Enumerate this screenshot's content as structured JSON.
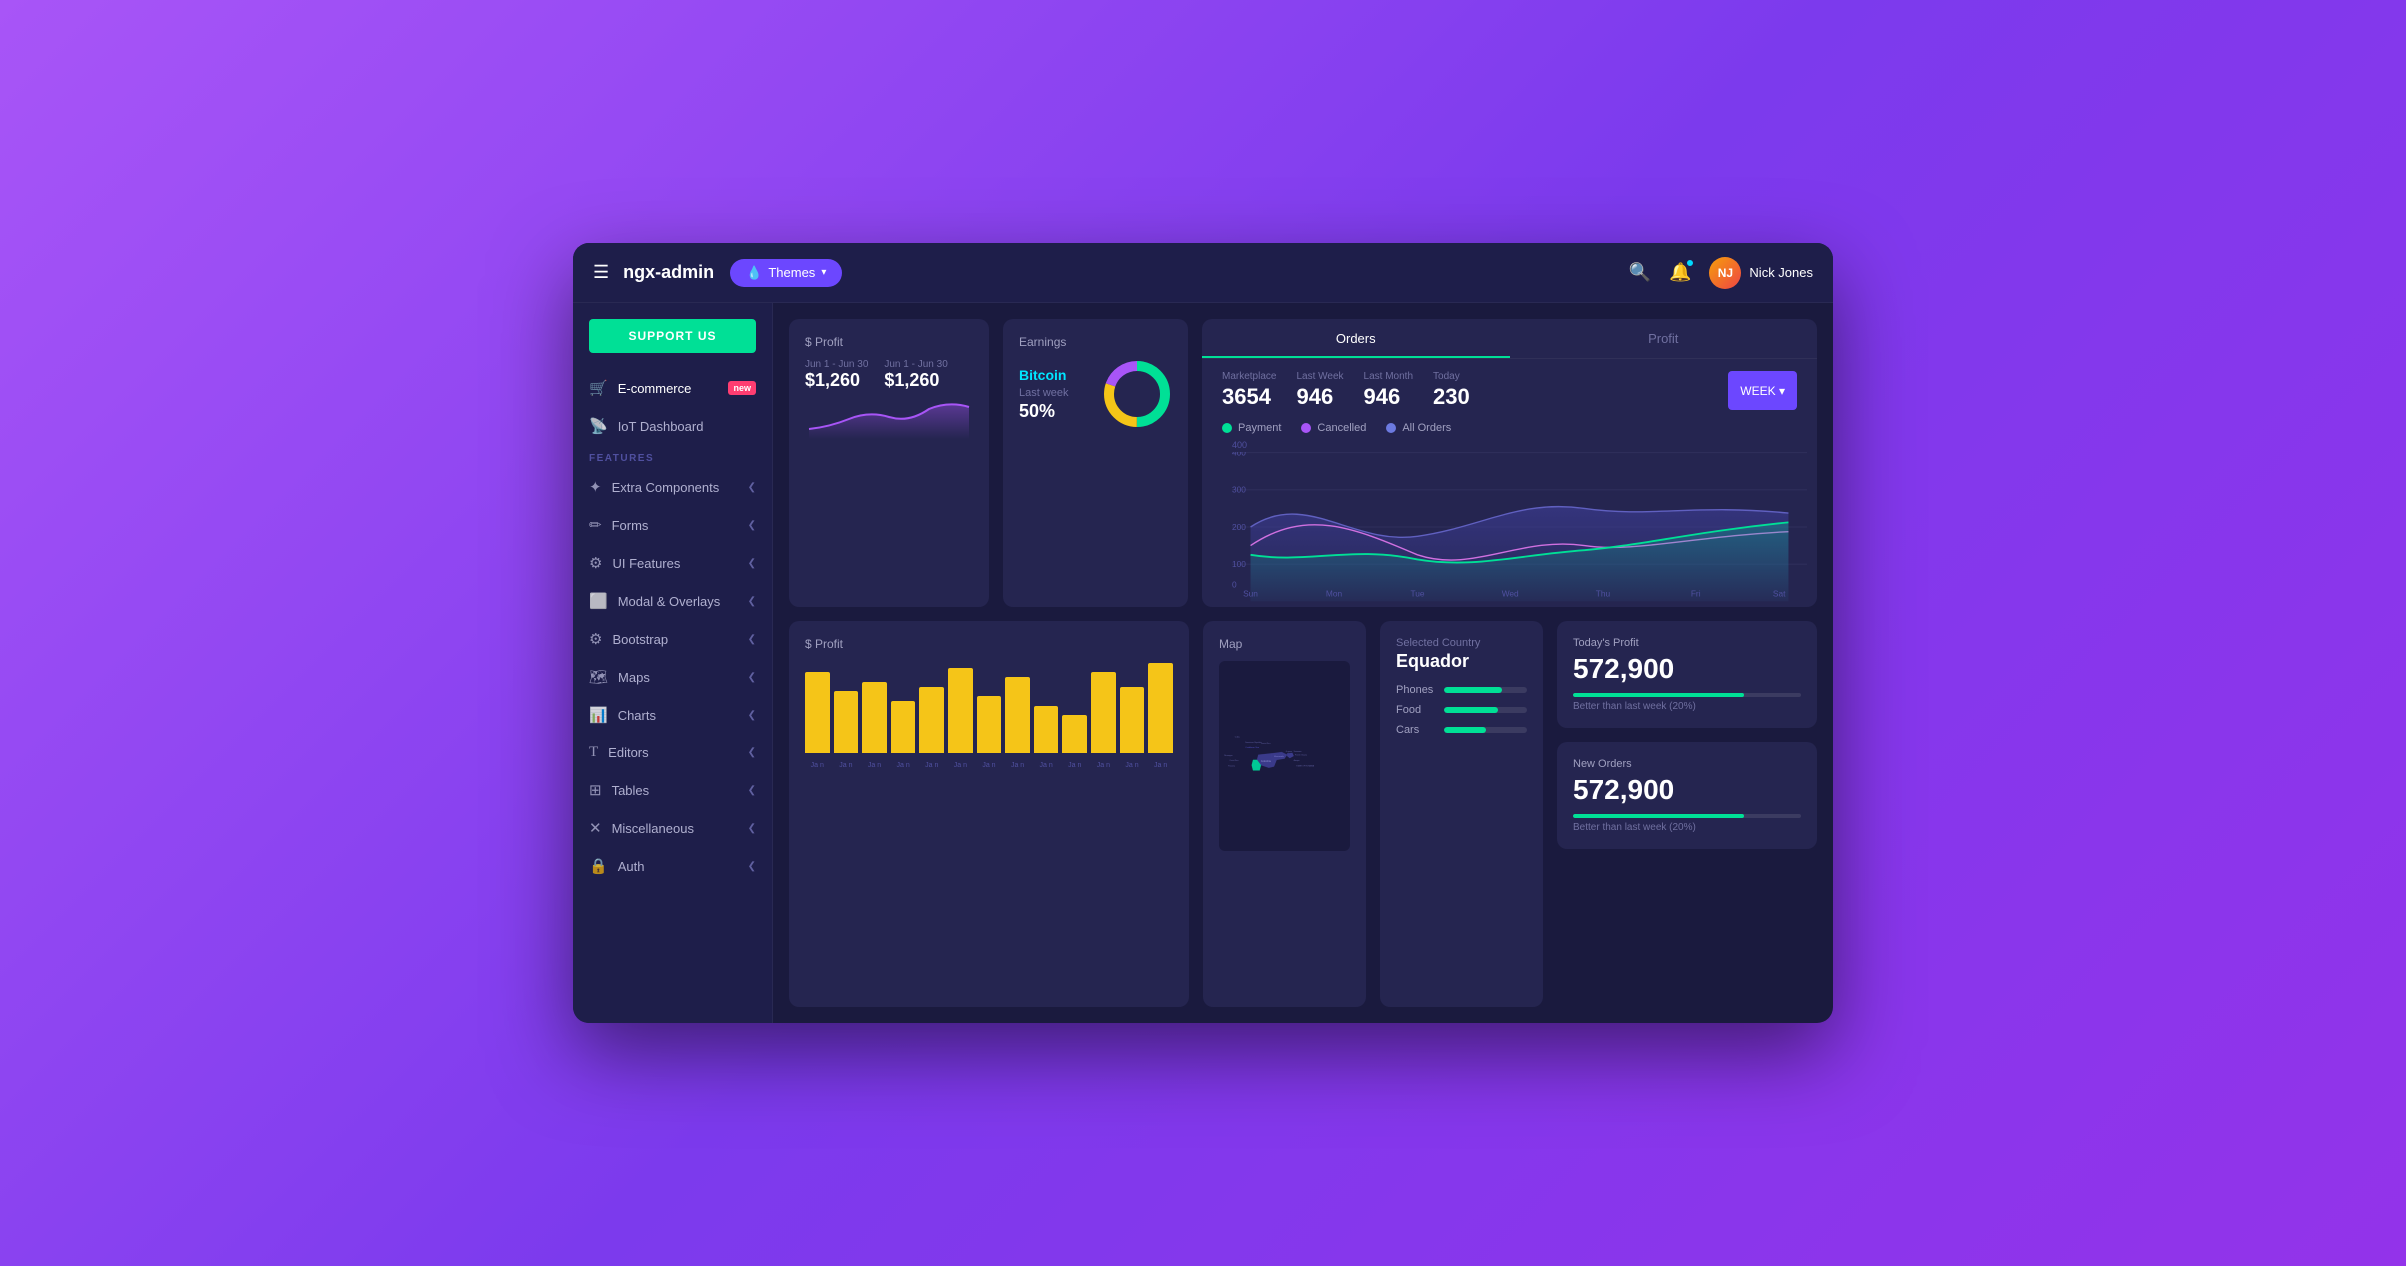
{
  "header": {
    "hamburger": "☰",
    "logo": "ngx-admin",
    "themes_label": "Themes",
    "themes_icon": "💧",
    "search_icon": "🔍",
    "notif_icon": "🔔",
    "user_name": "Nick Jones",
    "user_initials": "NJ"
  },
  "sidebar": {
    "support_label": "SUPPORT US",
    "nav_main": [
      {
        "id": "ecommerce",
        "label": "E-commerce",
        "icon": "🛒",
        "badge": "new"
      },
      {
        "id": "iot",
        "label": "IoT Dashboard",
        "icon": "📡"
      }
    ],
    "features_label": "FEATURES",
    "nav_features": [
      {
        "id": "extra",
        "label": "Extra Components",
        "icon": "✦",
        "chevron": "❮"
      },
      {
        "id": "forms",
        "label": "Forms",
        "icon": "✏",
        "chevron": "❮"
      },
      {
        "id": "ui",
        "label": "UI Features",
        "icon": "⚙",
        "chevron": "❮"
      },
      {
        "id": "modal",
        "label": "Modal & Overlays",
        "icon": "⬜",
        "chevron": "❮"
      },
      {
        "id": "bootstrap",
        "label": "Bootstrap",
        "icon": "⚙",
        "chevron": "❮"
      },
      {
        "id": "maps",
        "label": "Maps",
        "icon": "🗺",
        "chevron": "❮"
      },
      {
        "id": "charts",
        "label": "Charts",
        "icon": "📊",
        "chevron": "❮"
      },
      {
        "id": "editors",
        "label": "Editors",
        "icon": "T",
        "chevron": "❮"
      },
      {
        "id": "tables",
        "label": "Tables",
        "icon": "⊞",
        "chevron": "❮"
      },
      {
        "id": "misc",
        "label": "Miscellaneous",
        "icon": "✕",
        "chevron": "❮"
      },
      {
        "id": "auth",
        "label": "Auth",
        "icon": "🔒",
        "chevron": "❮"
      }
    ]
  },
  "profit_card": {
    "title": "$ Profit",
    "date1": "Jun 1 - Jun 30",
    "date2": "Jun 1 - Jun 30",
    "value1": "$1,260",
    "value2": "$1,260"
  },
  "earnings_card": {
    "title": "Earnings",
    "crypto": "Bitcoin",
    "last_week_label": "Last week",
    "percent": "50%",
    "donut_green": 50,
    "donut_yellow": 30,
    "donut_purple": 20
  },
  "orders": {
    "tab_orders": "Orders",
    "tab_profit": "Profit",
    "stats": [
      {
        "label": "Marketplace",
        "value": "3654"
      },
      {
        "label": "Last Week",
        "value": "946"
      },
      {
        "label": "Last Month",
        "value": "946"
      },
      {
        "label": "Today",
        "value": "230"
      }
    ],
    "legend": [
      {
        "label": "Payment",
        "color": "#00e096"
      },
      {
        "label": "Cancelled",
        "color": "#a855f7"
      },
      {
        "label": "All Orders",
        "color": "#6c7ae0"
      }
    ],
    "week_btn": "WEEK",
    "y_axis": [
      "0",
      "100",
      "200",
      "300",
      "400"
    ],
    "x_axis": [
      "Sun",
      "Mon",
      "Tue",
      "Wed",
      "Thu",
      "Fri",
      "Sat"
    ]
  },
  "bar_chart": {
    "title": "$ Profit",
    "bars": [
      85,
      65,
      75,
      55,
      70,
      90,
      60,
      80,
      50,
      40,
      85,
      70,
      95
    ],
    "labels": [
      "Ja n",
      "Ja n",
      "Ja n",
      "Ja n",
      "Ja n",
      "Ja n",
      "Ja n",
      "Ja n",
      "Ja n",
      "Ja n",
      "Ja n",
      "Ja n",
      "Ja n"
    ]
  },
  "map": {
    "title": "Map",
    "selected_country_label": "Selected Country",
    "country": "Equador",
    "stats": [
      {
        "label": "Phones",
        "pct": 70
      },
      {
        "label": "Food",
        "pct": 65
      },
      {
        "label": "Cars",
        "pct": 50
      }
    ]
  },
  "todays_profit": {
    "title": "Today's Profit",
    "value": "572,900",
    "progress": 75,
    "progress_label": "Better than last week (20%)"
  },
  "new_orders": {
    "title": "New Orders",
    "value": "572,900",
    "progress": 75,
    "progress_label": "Better than last week (20%)"
  }
}
